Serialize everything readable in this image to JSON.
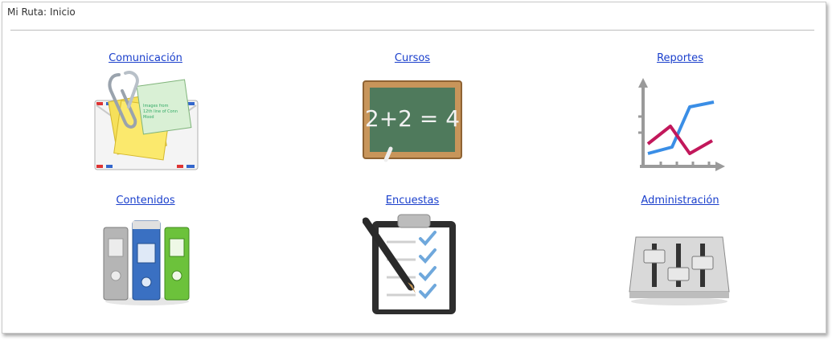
{
  "breadcrumb": {
    "label": "Mi Ruta:",
    "current": "Inicio"
  },
  "modules": [
    {
      "label": "Comunicación",
      "icon": "mail-attachment-icon"
    },
    {
      "label": "Cursos",
      "icon": "chalkboard-icon"
    },
    {
      "label": "Reportes",
      "icon": "line-chart-icon"
    },
    {
      "label": "Contenidos",
      "icon": "binders-icon"
    },
    {
      "label": "Encuestas",
      "icon": "clipboard-checklist-icon"
    },
    {
      "label": "Administración",
      "icon": "mixer-controls-icon"
    }
  ],
  "chalkboard_text": "2+2 = 4",
  "note_text": [
    "Images from",
    "12th line of Conn",
    "Mood"
  ],
  "colors": {
    "link": "#1a3fcc",
    "chalk_green": "#4f7a5c",
    "chart_blue": "#3a8ee6",
    "chart_red": "#c2185b"
  }
}
